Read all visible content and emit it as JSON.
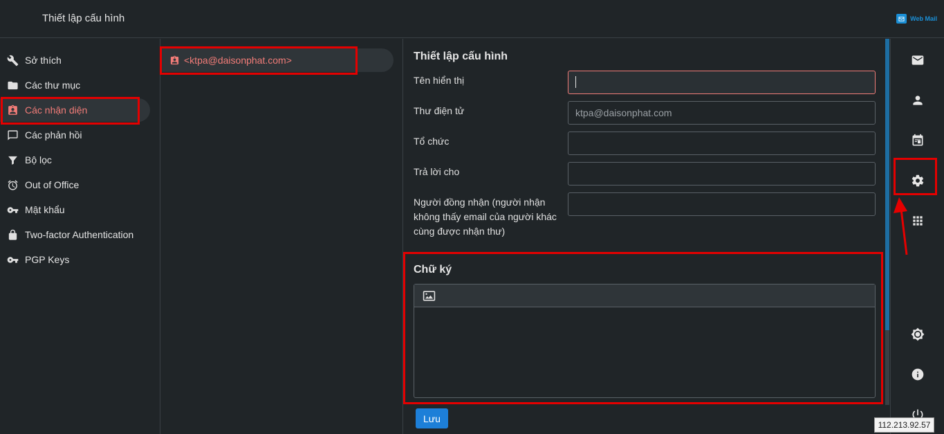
{
  "header": {
    "title": "Thiết lập cấu hình",
    "brand": "Web Mail",
    "brand_color": "#1a8fd6"
  },
  "sidebar": {
    "items": [
      {
        "label": "Sở thích",
        "icon": "wrench-icon"
      },
      {
        "label": "Các thư mục",
        "icon": "folder-icon"
      },
      {
        "label": "Các nhận diện",
        "icon": "id-badge-icon",
        "active": true
      },
      {
        "label": "Các phản hồi",
        "icon": "comment-icon"
      },
      {
        "label": "Bộ lọc",
        "icon": "filter-icon"
      },
      {
        "label": "Out of Office",
        "icon": "alarm-icon"
      },
      {
        "label": "Mật khẩu",
        "icon": "key-icon"
      },
      {
        "label": "Two-factor Authentication",
        "icon": "lock-icon"
      },
      {
        "label": "PGP Keys",
        "icon": "key-icon"
      }
    ]
  },
  "identities": {
    "items": [
      {
        "label": "<ktpa@daisonphat.com>",
        "icon": "id-badge-icon",
        "active": true
      }
    ]
  },
  "form": {
    "section_title": "Thiết lập cấu hình",
    "fields": {
      "display_name": {
        "label": "Tên hiển thị",
        "value": ""
      },
      "email": {
        "label": "Thư điện tử",
        "placeholder": "ktpa@daisonphat.com"
      },
      "organization": {
        "label": "Tổ chức",
        "value": ""
      },
      "reply_to": {
        "label": "Trả lời cho",
        "value": ""
      },
      "bcc": {
        "label": "Người đồng nhận (người nhận không thấy email của người khác cùng được nhận thư)",
        "value": ""
      }
    },
    "signature": {
      "title": "Chữ ký",
      "toolbar_icon": "image-icon",
      "value": ""
    },
    "save_label": "Lưu"
  },
  "rail": {
    "icons": [
      "mail-icon",
      "contacts-icon",
      "calendar-icon",
      "settings-icon",
      "apps-icon",
      "theme-icon",
      "info-icon",
      "power-icon"
    ]
  },
  "colors": {
    "accent": "#f17c78",
    "annotation": "#e50000",
    "primary_button": "#1d7fd8"
  },
  "ip_badge": "112.213.92.57"
}
